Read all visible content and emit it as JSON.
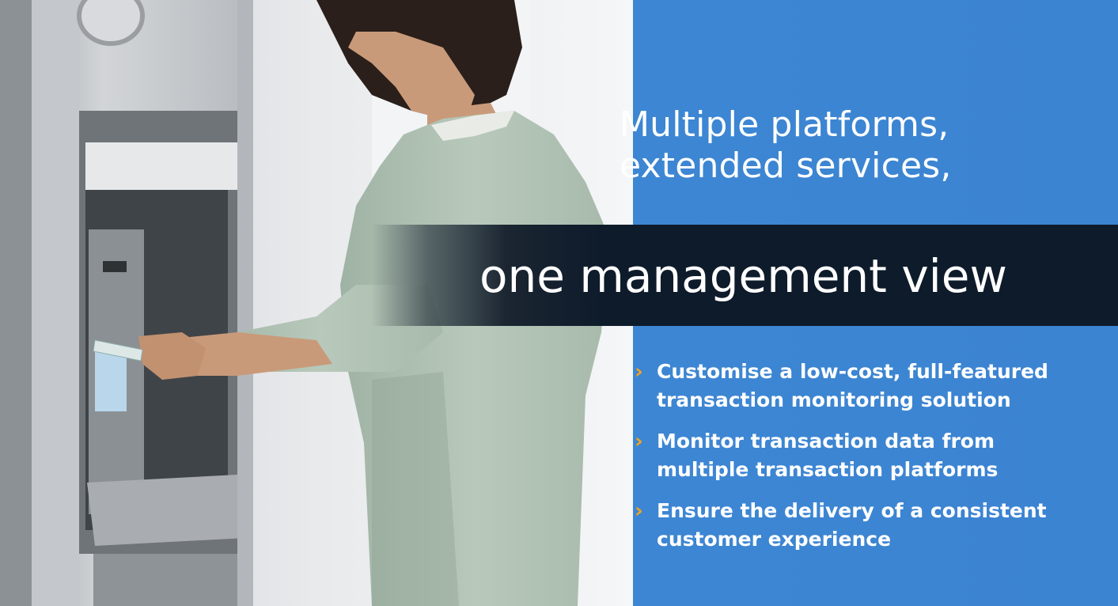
{
  "headline": {
    "line1": "Multiple platforms,",
    "line2": "extended services,"
  },
  "band": {
    "title": "one management view"
  },
  "bullets": [
    {
      "marker": "›",
      "text": "Customise a low-cost, full-featured\ntransaction monitoring solution"
    },
    {
      "marker": "›",
      "text": "Monitor  transaction data from\nmultiple transaction platforms"
    },
    {
      "marker": "›",
      "text": "Ensure the delivery of a consistent\ncustomer experience"
    }
  ],
  "colors": {
    "background_blue": "#3b84d2",
    "band_dark": "#0e1b2b",
    "bullet_accent": "#f2a51c",
    "text": "#ffffff"
  },
  "image": {
    "subject": "man-at-atm-photo"
  }
}
